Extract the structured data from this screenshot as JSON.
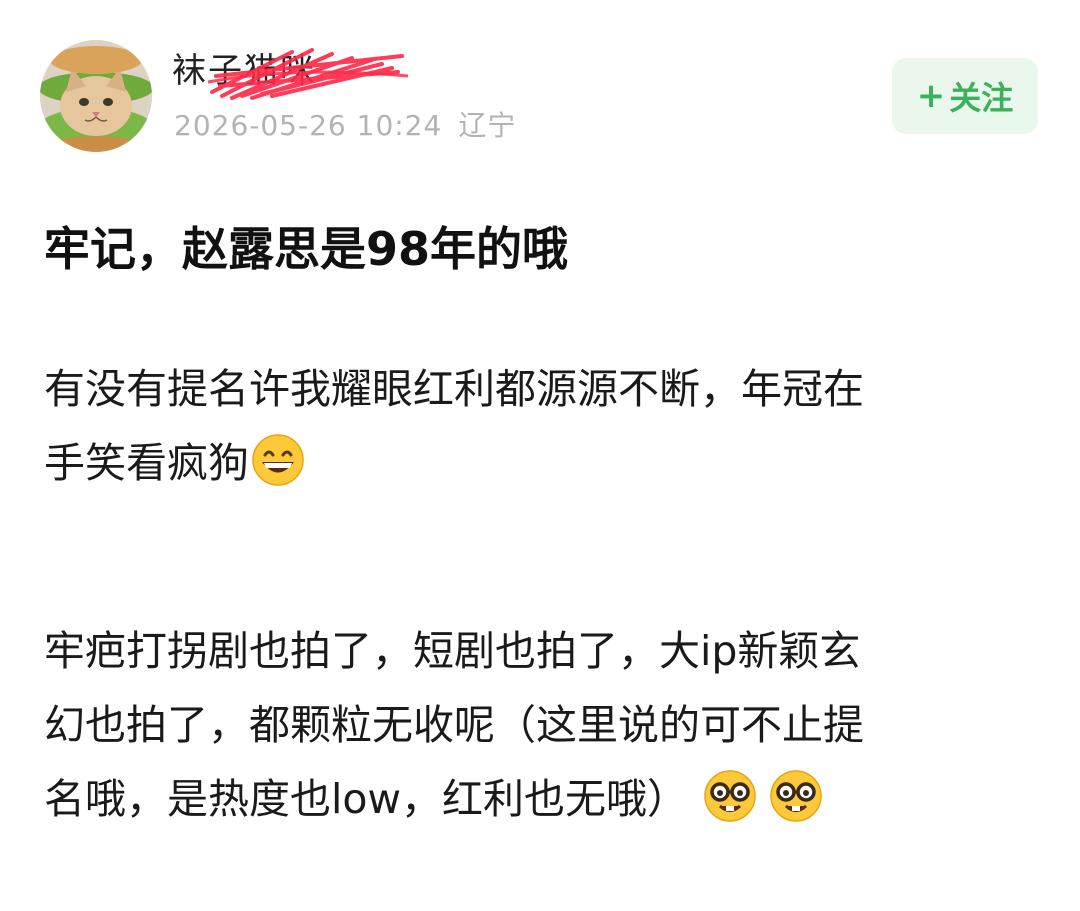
{
  "author": {
    "username": "袜子猫咪",
    "avatar_icon": "cat-with-lettuce-avatar",
    "post_date": "2026-05-26 10:24",
    "location": "辽宁"
  },
  "follow_button": {
    "plus": "+",
    "label": "关注"
  },
  "post": {
    "title": "牢记，赵露思是98年的哦",
    "paragraph1": {
      "line1": "有没有提名许我耀眼红利都源源不断，年冠在",
      "line2": "手笑看疯狗",
      "emoji": "grinning-face-icon"
    },
    "paragraph2": {
      "line1": "牢疤打拐剧也拍了，短剧也拍了，大ip新颖玄",
      "line2": "幻也拍了，都颗粒无收呢（这里说的可不止提",
      "line3": "名哦，是热度也low，红利也无哦）",
      "emojis": [
        "nerd-face-icon",
        "nerd-face-icon"
      ]
    }
  },
  "colors": {
    "accent_green": "#3bb15a",
    "follow_bg": "#e9f7ec",
    "meta_gray": "#b3b3b3",
    "redaction_red": "#ff2a4a"
  }
}
